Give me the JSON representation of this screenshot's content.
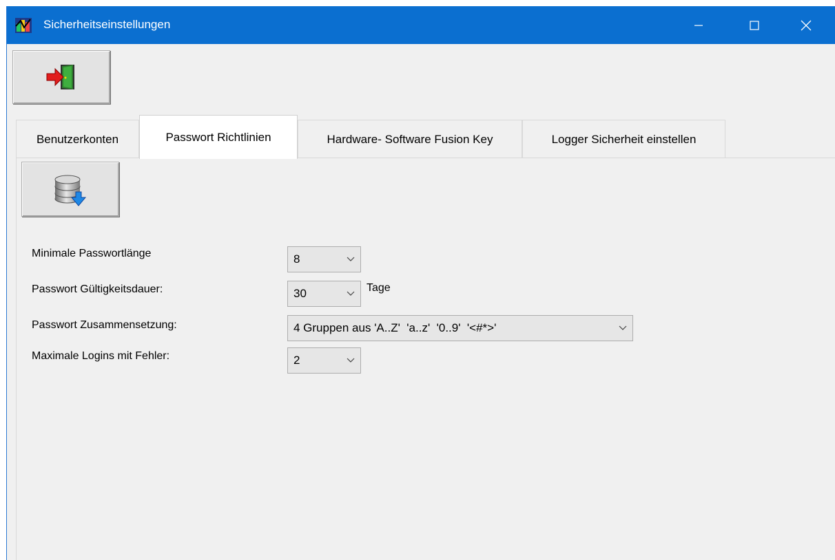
{
  "window": {
    "title": "Sicherheitseinstellungen"
  },
  "toolbar": {
    "exit_icon": "exit-door-icon",
    "save_icon": "database-save-icon"
  },
  "tabs": [
    {
      "label": "Benutzerkonten",
      "active": false
    },
    {
      "label": "Passwort Richtlinien",
      "active": true
    },
    {
      "label": "Hardware- Software Fusion Key",
      "active": false
    },
    {
      "label": "Logger Sicherheit einstellen",
      "active": false
    }
  ],
  "policy": {
    "min_length": {
      "label": "Minimale Passwortlänge",
      "value": "8"
    },
    "validity": {
      "label": "Passwort Gültigkeitsdauer:",
      "value": "30",
      "unit": "Tage"
    },
    "composition": {
      "label": "Passwort Zusammensetzung:",
      "value": "4 Gruppen aus 'A..Z'  'a..z'  '0..9'  '<#*>'"
    },
    "max_logins": {
      "label": "Maximale  Logins  mit Fehler:",
      "value": "2"
    }
  },
  "colors": {
    "titlebar": "#0b6fd0",
    "window_bg": "#f0f0f0"
  }
}
